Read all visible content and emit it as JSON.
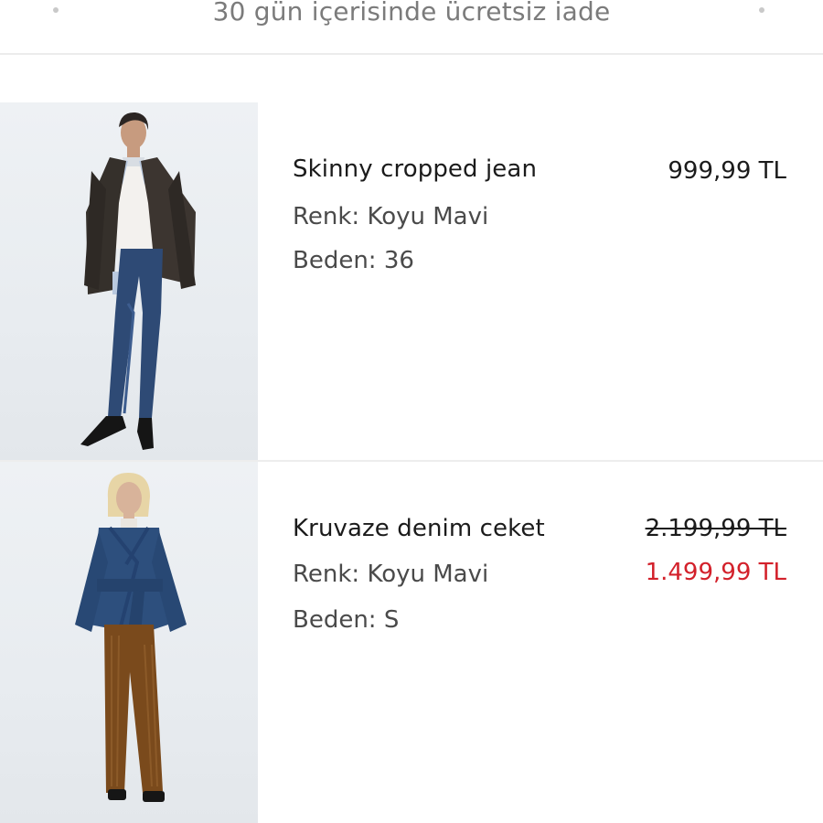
{
  "banner": {
    "text": "30 gün içerisinde ücretsiz iade"
  },
  "items": [
    {
      "name": "Skinny cropped jean",
      "color_line": "Renk: Koyu Mavi",
      "size_line": "Beden: 36",
      "price": "999,99 TL"
    },
    {
      "name": "Kruvaze denim ceket",
      "color_line": "Renk: Koyu Mavi",
      "size_line": "Beden: S",
      "old_price": "2.199,99 TL",
      "sale_price": "1.499,99 TL"
    }
  ],
  "colors": {
    "sale_red": "#d3212b",
    "banner_text": "#7b7b7b",
    "divider": "#ececec"
  }
}
